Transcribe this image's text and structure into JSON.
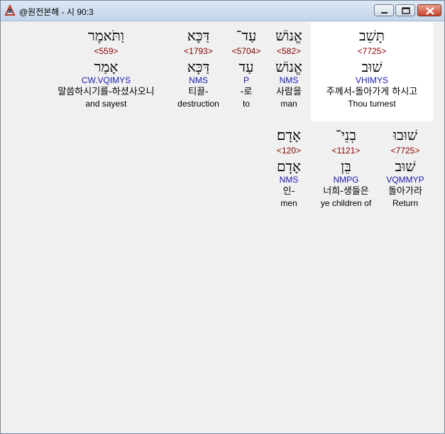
{
  "window": {
    "title": "@원전본해 - 시 90:3"
  },
  "colors": {
    "strongs": "#8b0000",
    "morph": "#1a1ab0",
    "selected_bg": "#ffffff"
  },
  "rows": [
    [
      {
        "word": "תָּשֵׁב",
        "strongs": "<7725>",
        "lemma": "שׁוּב",
        "morph": "VHIMYS",
        "korean": "주께서-돌아가게 하시고",
        "english": "Thou turnest",
        "selected": true
      },
      {
        "word": "אֱנוֹשׁ",
        "strongs": "<582>",
        "lemma": "אֱנוֹשׁ",
        "morph": "NMS",
        "korean": "사람을",
        "english": "man"
      },
      {
        "word": "עַד־",
        "strongs": "<5704>",
        "lemma": "עַד",
        "morph": "P",
        "korean": "-로",
        "english": "to"
      },
      {
        "word": "דַּכָּא",
        "strongs": "<1793>",
        "lemma": "דַּכָּא",
        "morph": "NMS",
        "korean": "티끌-",
        "english": "destruction"
      },
      {
        "word": "וַתֹּאמֶר",
        "strongs": "<559>",
        "lemma": "אָמַר",
        "morph": "CW.VQIMYS",
        "korean": "말씀하시기를-하셨사오니",
        "english": "and sayest"
      }
    ],
    [
      {
        "word": "שׁוּבוּ",
        "strongs": "<7725>",
        "lemma": "שׁוּב",
        "morph": "VQMMYP",
        "korean": "돌아가라",
        "english": "Return"
      },
      {
        "word": "בְנֵי־",
        "strongs": "<1121>",
        "lemma": "בֵּן",
        "morph": "NMPG",
        "korean": "너희-생들은",
        "english": "ye children of"
      },
      {
        "word": "אָדָם׃",
        "strongs": "<120>",
        "lemma": "אָדָם",
        "morph": "NMS",
        "korean": "인-",
        "english": "men"
      }
    ]
  ]
}
